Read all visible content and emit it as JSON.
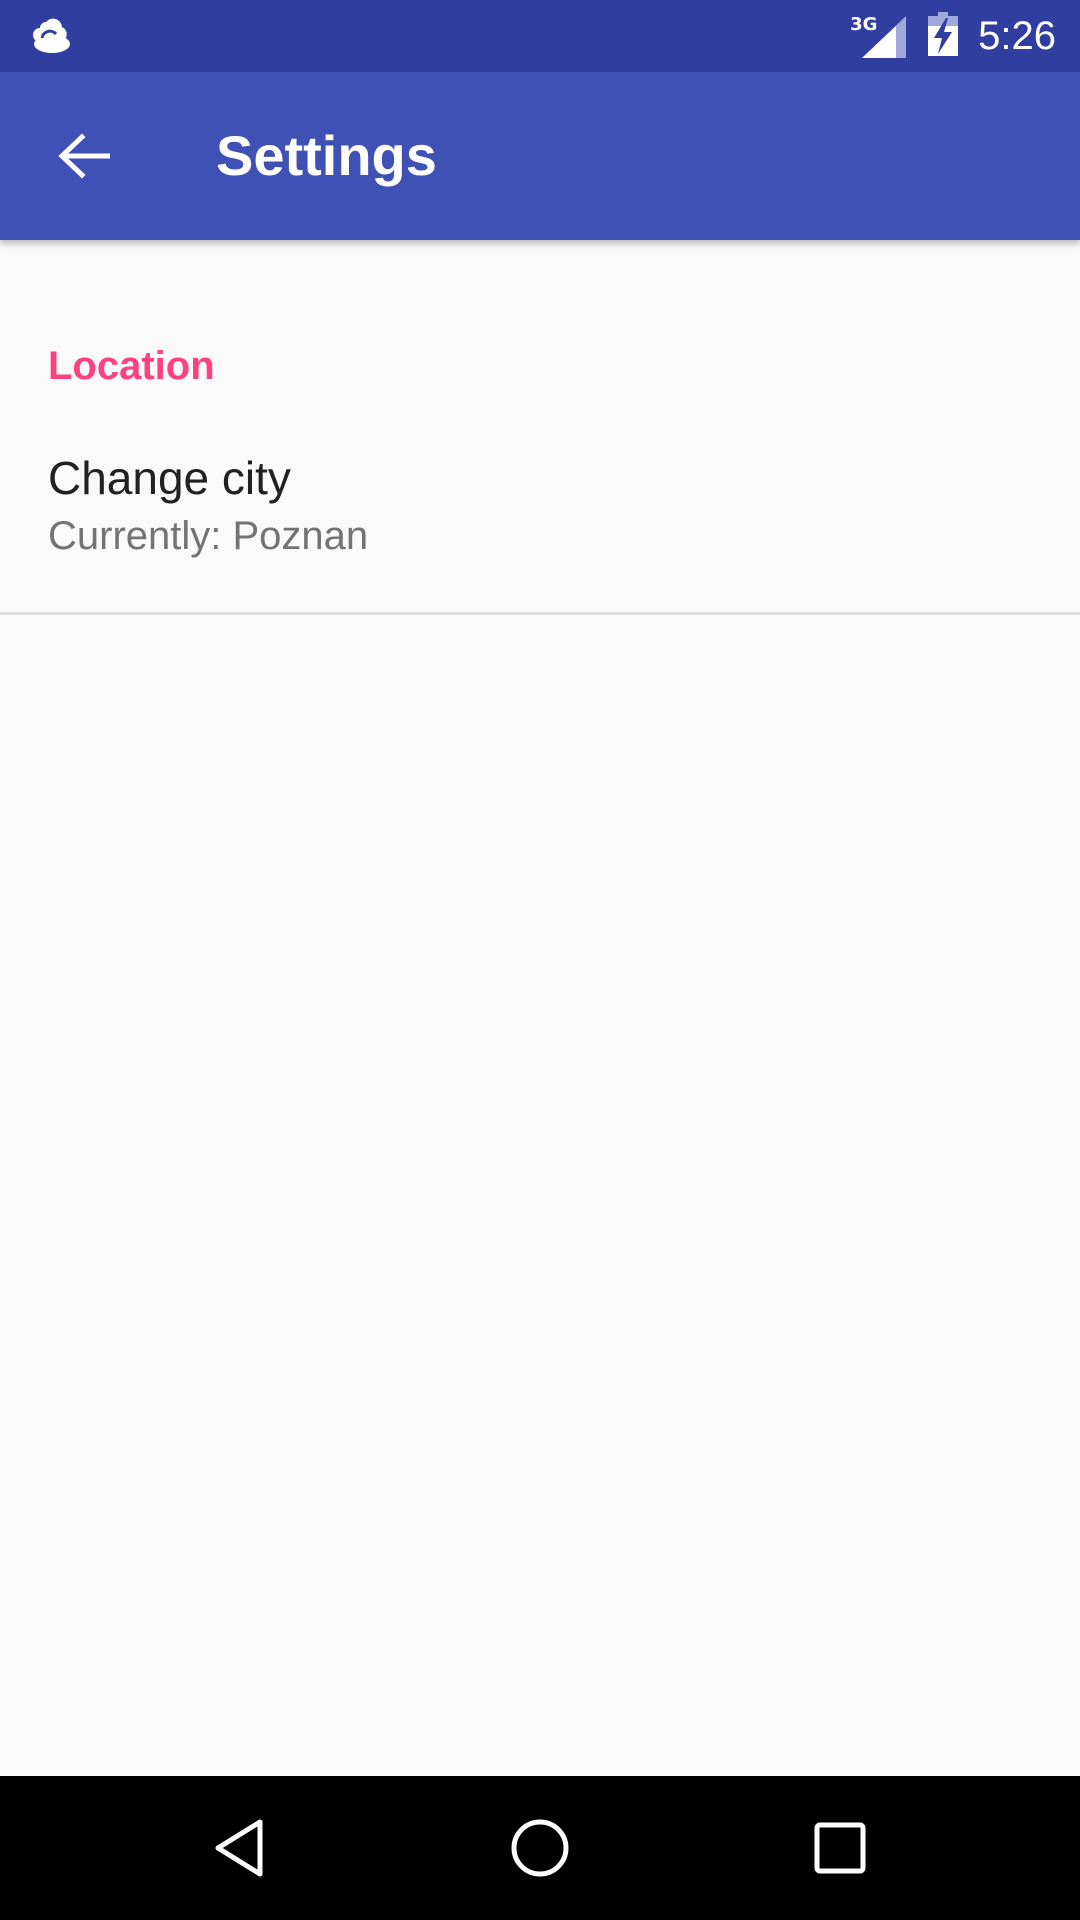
{
  "status_bar": {
    "weather_icon": "cloud-icon",
    "network_type": "3G",
    "signal_icon": "cell-signal-icon",
    "battery_icon": "battery-charging-icon",
    "time": "5:26",
    "background_color": "#303f9f"
  },
  "app_bar": {
    "back_icon": "arrow-back-icon",
    "title": "Settings",
    "background_color": "#3f51b5"
  },
  "preferences": {
    "category_title": "Location",
    "category_color": "#ff4081",
    "items": [
      {
        "title": "Change city",
        "summary": "Currently: Poznan"
      }
    ]
  },
  "nav_bar": {
    "back_icon": "nav-back-icon",
    "home_icon": "nav-home-icon",
    "recents_icon": "nav-recents-icon"
  }
}
